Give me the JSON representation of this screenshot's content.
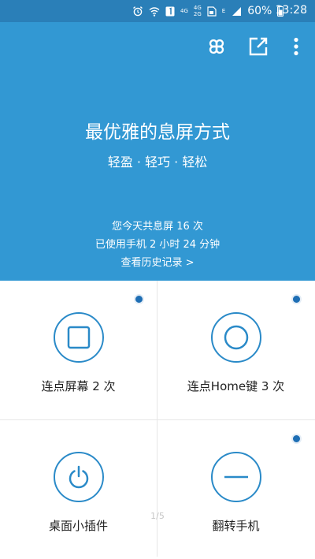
{
  "status_bar": {
    "net_4g": "4G",
    "net_2g": "2G",
    "net_e": "E",
    "battery": "60%",
    "time": "13:28"
  },
  "header": {
    "icons": [
      "clover-icon",
      "share-icon",
      "more-vert-icon"
    ],
    "title": "最优雅的息屏方式",
    "subtitle": "轻盈 · 轻巧 · 轻松",
    "stats_line1": "您今天共息屏 16 次",
    "stats_line2": "已使用手机 2 小时 24 分钟",
    "history_link": "查看历史记录 >"
  },
  "modes": [
    {
      "label": "连点屏幕 2 次",
      "icon": "square-icon",
      "selected": true
    },
    {
      "label": "连点Home键 3 次",
      "icon": "circle-icon",
      "selected": true
    },
    {
      "label": "桌面小插件",
      "icon": "power-icon",
      "selected": false
    },
    {
      "label": "翻转手机",
      "icon": "minus-icon",
      "selected": true
    }
  ],
  "pager": "1/5",
  "colors": {
    "status_bar": "#2a7fb8",
    "header": "#3298d3",
    "accent": "#2a8ac8",
    "indicator": "#1e6eb4"
  }
}
